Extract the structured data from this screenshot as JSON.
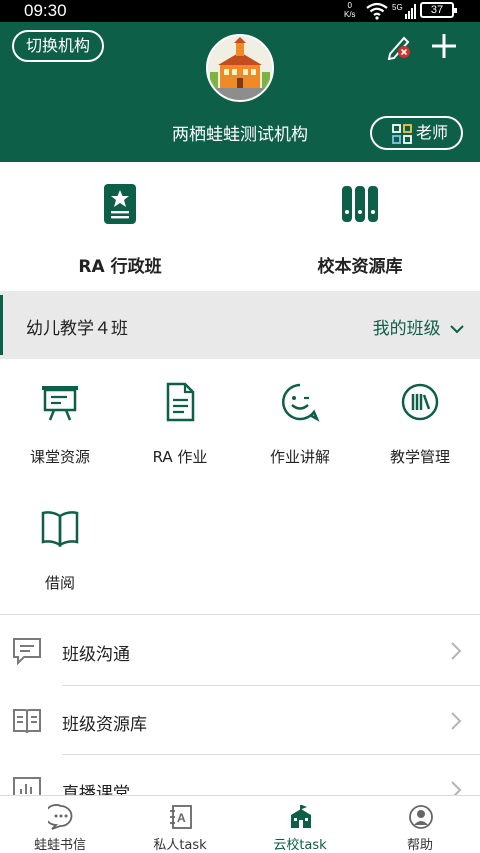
{
  "status_bar": {
    "time": "09:30",
    "speed_value": "0",
    "speed_unit": "K/s",
    "battery": "37",
    "icons": [
      "wifi-icon",
      "signal-5g-icon",
      "battery-icon"
    ]
  },
  "header": {
    "switch_label": "切换机构",
    "org_name": "两栖蛙蛙测试机构",
    "role_label": "老师",
    "icons": [
      "edit-icon",
      "add-icon",
      "school-avatar",
      "switch-role-icon"
    ]
  },
  "quick_entries": [
    {
      "label": "RA 行政班",
      "icon": "class-badge-icon"
    },
    {
      "label": "校本资源库",
      "icon": "books-icon"
    }
  ],
  "class_bar": {
    "class_name": "幼儿教学４班",
    "my_class_label": "我的班级"
  },
  "features": [
    {
      "label": "课堂资源",
      "icon": "presentation-board-icon"
    },
    {
      "label": "RA 作业",
      "icon": "document-icon"
    },
    {
      "label": "作业讲解",
      "icon": "smile-chat-icon"
    },
    {
      "label": "教学管理",
      "icon": "bookshelf-icon"
    },
    {
      "label": "借阅",
      "icon": "open-book-icon"
    }
  ],
  "list": [
    {
      "label": "班级沟通",
      "icon": "chat-icon"
    },
    {
      "label": "班级资源库",
      "icon": "book-list-icon"
    },
    {
      "label": "直播课堂",
      "icon": "live-chart-icon"
    }
  ],
  "tabs": [
    {
      "label": "蛙蛙书信",
      "icon": "message-icon",
      "active": false
    },
    {
      "label": "私人task",
      "icon": "notebook-a-icon",
      "active": false
    },
    {
      "label": "云校task",
      "icon": "school-building-icon",
      "active": true
    },
    {
      "label": "帮助",
      "icon": "help-person-icon",
      "active": false
    }
  ],
  "colors": {
    "brand": "#0e5f48",
    "class_bar_bg": "#e9e9e9"
  }
}
